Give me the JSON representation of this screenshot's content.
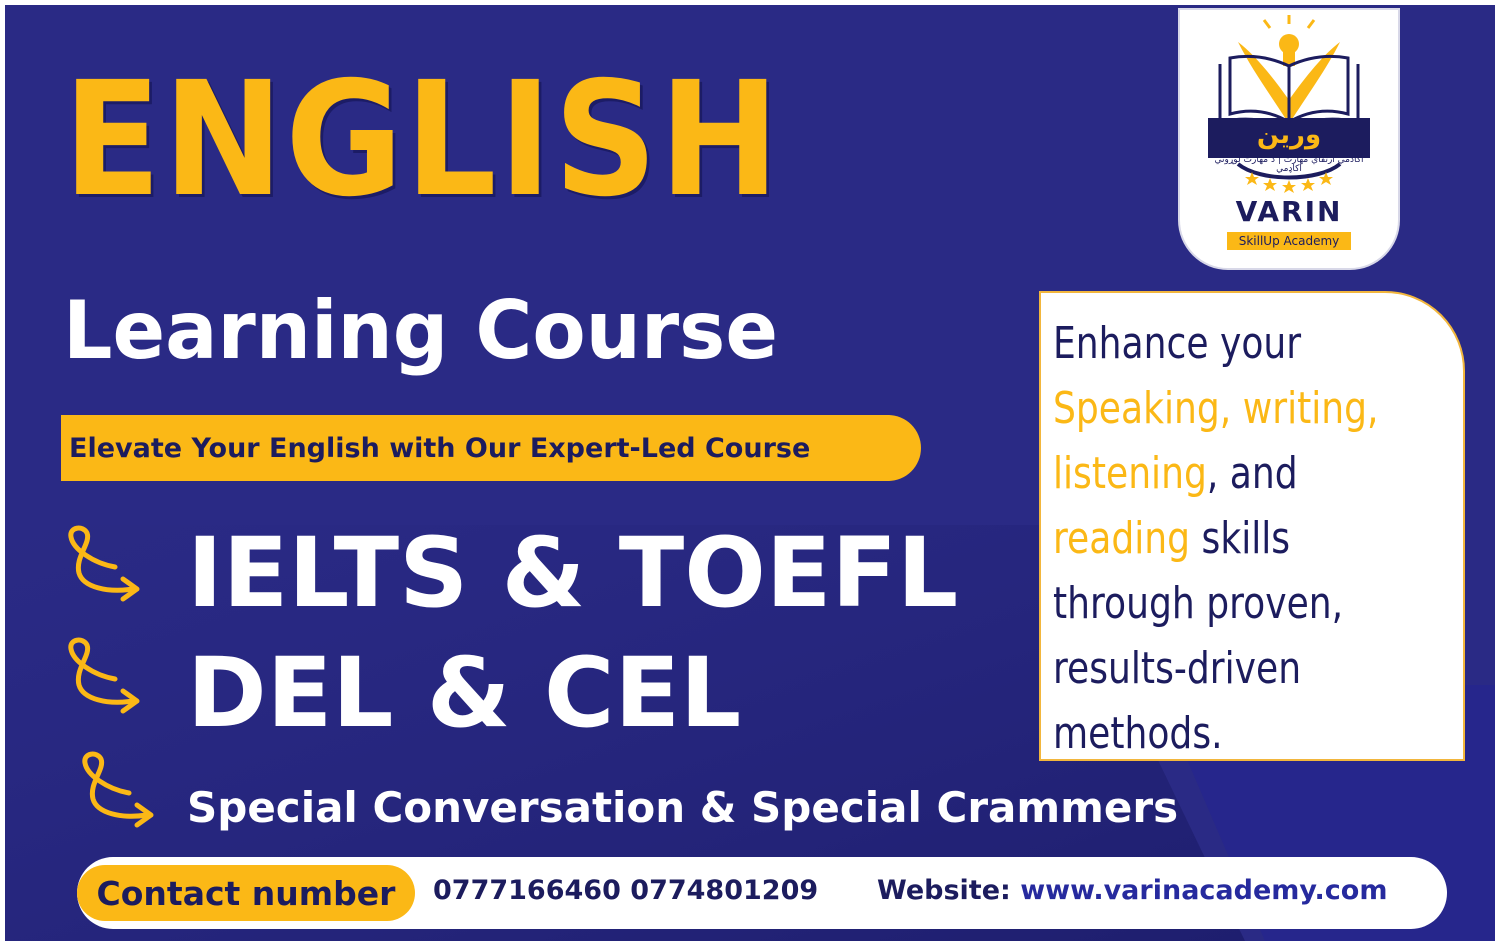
{
  "colors": {
    "background": "#2a2a85",
    "accent": "#fbb816",
    "navy_text": "#1c1c5e",
    "white": "#ffffff",
    "info_border": "#f2b63d"
  },
  "logo": {
    "arabic_name": "ورين",
    "arabic_subtitle": "أكادمي ارتقاي مهارت | د مهارت لوړوني اکاډمي",
    "name": "VARIN",
    "tagline": "SkillUp Academy"
  },
  "headline": {
    "main": "ENGLISH",
    "sub": "Learning Course"
  },
  "tagline": "Elevate Your English with Our Expert-Led Course",
  "courses": [
    {
      "label": "IELTS & TOEFL",
      "icon": "curly-arrow-icon"
    },
    {
      "label": "DEL & CEL",
      "icon": "curly-arrow-icon"
    },
    {
      "label": "Special Conversation & Special Crammers",
      "icon": "curly-arrow-icon"
    }
  ],
  "info": {
    "intro": "Enhance your",
    "skills_1": "Speaking, writing,",
    "skills_2": "listening",
    "connector_1": ", and",
    "skills_3": "reading",
    "connector_2": " skills",
    "line_5": "through proven,",
    "line_6": "results-driven",
    "line_7": "methods."
  },
  "footer": {
    "contact_label": "Contact number",
    "phone_1": "0777166460",
    "phone_2": "0774801209",
    "website_label": "Website:",
    "website_url": "www.varinacademy.com"
  }
}
